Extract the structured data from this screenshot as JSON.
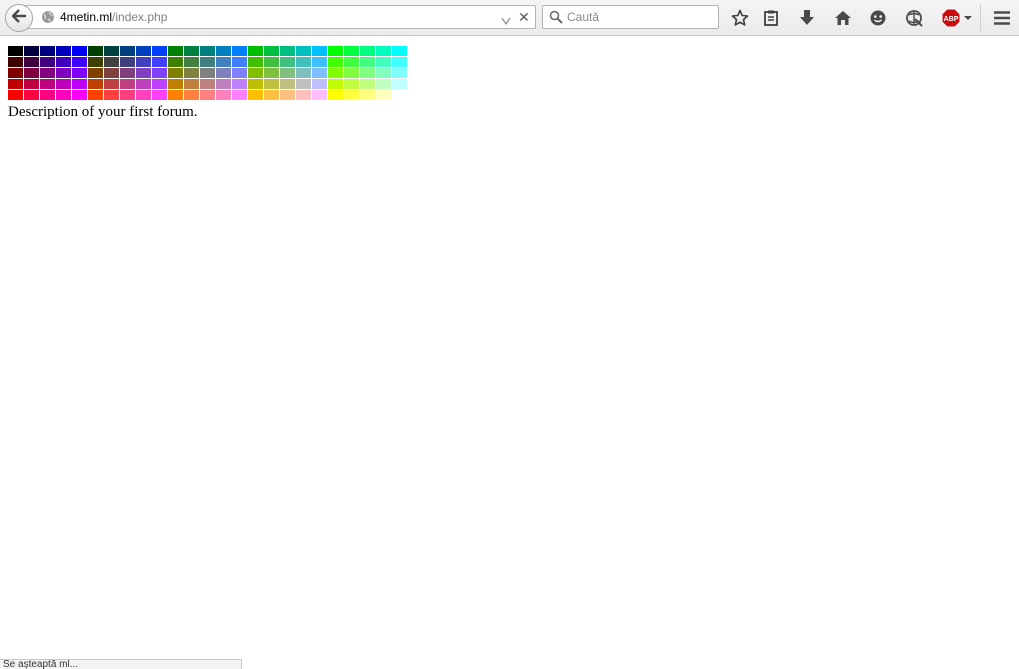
{
  "browser": {
    "url_host": "4metin.ml",
    "url_path": "/index.php",
    "search_placeholder": "Caută",
    "clear_glyph": "✕",
    "abp_label": "ABP",
    "icons": [
      "back-arrow-icon",
      "globe-icon",
      "dropdown-arrow-icon",
      "close-icon",
      "search-icon",
      "star-icon",
      "reading-list-icon",
      "download-icon",
      "home-icon",
      "chat-icon",
      "sync-icon",
      "adblock-icon",
      "menu-icon"
    ]
  },
  "status": {
    "text": "Se așteaptă ml..."
  },
  "page": {
    "description": "Description of your first forum."
  },
  "palette": {
    "rows": [
      [
        "#000000",
        "#000040",
        "#000080",
        "#0000bf",
        "#0000ff",
        "#004000",
        "#004040",
        "#004080",
        "#0040bf",
        "#0040ff",
        "#008000",
        "#008040",
        "#008080",
        "#0080bf",
        "#0080ff",
        "#00bf00",
        "#00bf40",
        "#00bf80",
        "#00bfbf",
        "#00bfff",
        "#00ff00",
        "#00ff40",
        "#00ff80",
        "#00ffbf",
        "#00ffff"
      ],
      [
        "#400000",
        "#400040",
        "#400080",
        "#4000bf",
        "#4000ff",
        "#404000",
        "#404040",
        "#404080",
        "#4040bf",
        "#4040ff",
        "#408000",
        "#408040",
        "#408080",
        "#4080bf",
        "#4080ff",
        "#40bf00",
        "#40bf40",
        "#40bf80",
        "#40bfbf",
        "#40bfff",
        "#40ff00",
        "#40ff40",
        "#40ff80",
        "#40ffbf",
        "#40ffff"
      ],
      [
        "#800000",
        "#800040",
        "#800080",
        "#8000bf",
        "#8000ff",
        "#804000",
        "#804040",
        "#804080",
        "#8040bf",
        "#8040ff",
        "#808000",
        "#808040",
        "#808080",
        "#8080bf",
        "#8080ff",
        "#80bf00",
        "#80bf40",
        "#80bf80",
        "#80bfbf",
        "#80bfff",
        "#80ff00",
        "#80ff40",
        "#80ff80",
        "#80ffbf",
        "#80ffff"
      ],
      [
        "#bf0000",
        "#bf0040",
        "#bf0080",
        "#bf00bf",
        "#bf00ff",
        "#bf4000",
        "#bf4040",
        "#bf4080",
        "#bf40bf",
        "#bf40ff",
        "#bf8000",
        "#bf8040",
        "#bf8080",
        "#bf80bf",
        "#bf80ff",
        "#bfbf00",
        "#bfbf40",
        "#bfbf80",
        "#bfbfbf",
        "#bfbfff",
        "#bfff00",
        "#bfff40",
        "#bfff80",
        "#bfffbf",
        "#bfffff"
      ],
      [
        "#ff0000",
        "#ff0040",
        "#ff0080",
        "#ff00bf",
        "#ff00ff",
        "#ff4000",
        "#ff4040",
        "#ff4080",
        "#ff40bf",
        "#ff40ff",
        "#ff8000",
        "#ff8040",
        "#ff8080",
        "#ff80bf",
        "#ff80ff",
        "#ffbf00",
        "#ffbf40",
        "#ffbf80",
        "#ffbfbf",
        "#ffbfff",
        "#ffff00",
        "#ffff40",
        "#ffff80",
        "#ffffbf",
        "#ffffff"
      ]
    ]
  }
}
